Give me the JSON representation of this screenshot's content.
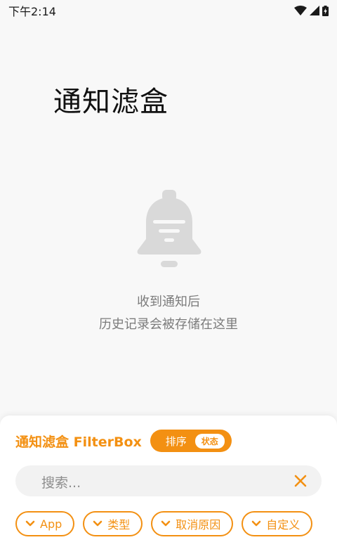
{
  "status_bar": {
    "time": "下午2:14",
    "icons": [
      "wifi-icon",
      "cellular-signal-icon",
      "battery-charging-icon"
    ]
  },
  "page_title": "通知滤盒",
  "empty_state": {
    "icon": "bell-icon",
    "line1": "收到通知后",
    "line2": "历史记录会被存储在这里"
  },
  "panel": {
    "app_name": "通知滤盒 FilterBox",
    "sort": {
      "label": "排序",
      "value": "状态"
    },
    "search": {
      "placeholder": "搜索...",
      "clear_icon": "close-icon"
    },
    "filters": [
      {
        "label": "App"
      },
      {
        "label": "类型"
      },
      {
        "label": "取消原因"
      },
      {
        "label": "自定义"
      }
    ]
  },
  "colors": {
    "accent": "#f39012",
    "background": "#f8f8f8",
    "panel": "#ffffff",
    "search_bg": "#f2f2f2",
    "empty_text": "#7b7b7b",
    "icon_gray": "#d9d9d9"
  }
}
